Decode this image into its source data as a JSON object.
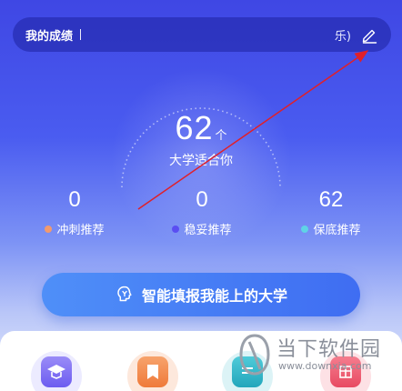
{
  "score_bar": {
    "label": "我的成绩",
    "detail": "乐)"
  },
  "summary": {
    "count": "62",
    "unit": "个",
    "caption": "大学适合你"
  },
  "stats": [
    {
      "value": "0",
      "label": "冲刺推荐",
      "color": "#f29a6e"
    },
    {
      "value": "0",
      "label": "稳妥推荐",
      "color": "#5a4ef2"
    },
    {
      "value": "62",
      "label": "保底推荐",
      "color": "#5fd3e6"
    }
  ],
  "cta": {
    "label": "智能填报我能上的大学"
  },
  "features": [
    {
      "icon": "graduation-cap-icon",
      "color": "#7c6cf0",
      "bg": "#ecebff"
    },
    {
      "icon": "bookmark-icon",
      "color": "#f08a4b",
      "bg": "#fde8dc"
    },
    {
      "icon": "list-icon",
      "color": "#2fb6c9",
      "bg": "#dcf3f6"
    },
    {
      "icon": "table-icon",
      "color": "#ef5d73",
      "bg": "#fde1e5"
    }
  ],
  "watermark": {
    "title": "当下软件园",
    "url": "www.downxia.com"
  },
  "colors": {
    "accent": "#4a5cf0",
    "annotation_arrow": "#e0202a"
  }
}
